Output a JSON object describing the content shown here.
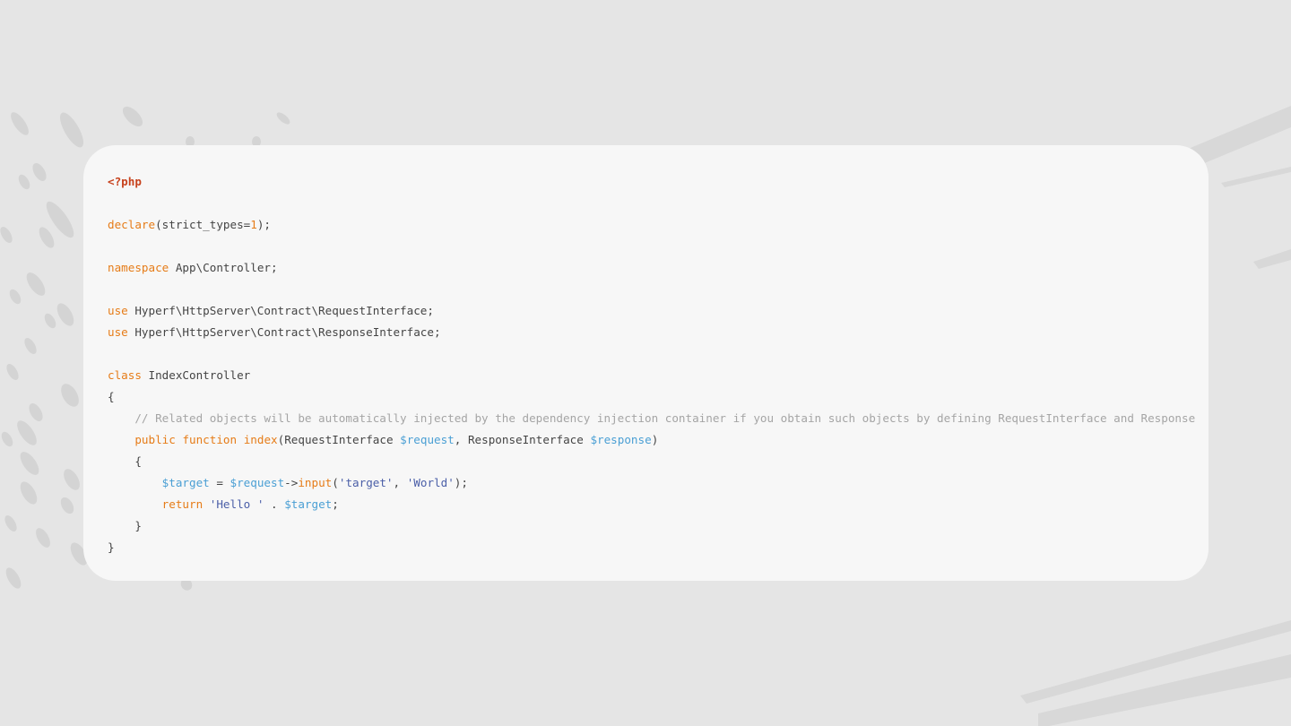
{
  "colors": {
    "background": "#e5e5e5",
    "card": "#f7f7f7",
    "php_tag": "#c7421d",
    "keyword": "#e67c18",
    "variable": "#4a9fd4",
    "string": "#4b5fa8",
    "comment": "#a5a5a5",
    "plain": "#444444"
  },
  "code": {
    "php_open": "<?php",
    "declare_kw": "declare",
    "declare_args_open": "(strict_types=",
    "declare_value": "1",
    "declare_args_close": ");",
    "namespace_kw": "namespace",
    "namespace_name": " App\\Controller;",
    "use_kw": "use",
    "use_request": " Hyperf\\HttpServer\\Contract\\RequestInterface;",
    "use_response": " Hyperf\\HttpServer\\Contract\\ResponseInterface;",
    "class_kw": "class",
    "class_name": " IndexController",
    "open_brace": "{",
    "close_brace": "}",
    "comment": "// Related objects will be automatically injected by the dependency injection container if you obtain such objects by defining RequestInterface and ResponseInterface on the method parameters",
    "public_kw": "public",
    "function_kw": "function",
    "method_name": "index",
    "param_type_1": "(RequestInterface ",
    "param_var_1": "$request",
    "param_sep": ", ResponseInterface ",
    "param_var_2": "$response",
    "param_close": ")",
    "target_var": "$target",
    "assign": " = ",
    "request_var": "$request",
    "arrow": "->",
    "input_fn": "input",
    "paren_open": "(",
    "arg_target": "'target'",
    "comma": ", ",
    "arg_world": "'World'",
    "call_close": ");",
    "return_kw": "return",
    "hello_str": "'Hello '",
    "concat": " . ",
    "semicolon": ";"
  }
}
